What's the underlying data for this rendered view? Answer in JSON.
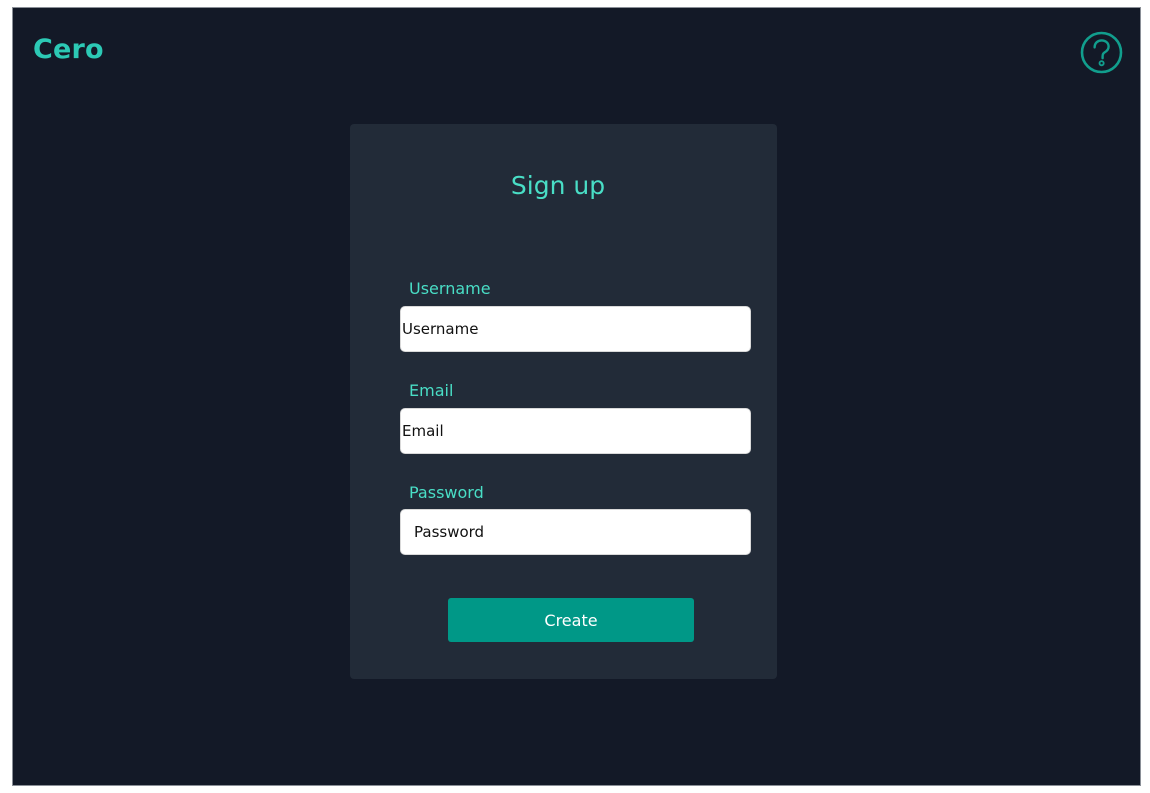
{
  "app": {
    "logo": "Cero",
    "help_icon": "question-circle-icon"
  },
  "signup": {
    "title": "Sign up",
    "username_label": "Username",
    "username_placeholder": "Username",
    "email_label": "Email",
    "email_placeholder": "Email",
    "password_label": "Password",
    "password_placeholder": "Password",
    "create_label": "Create"
  },
  "colors": {
    "background": "#131927",
    "card": "#222b38",
    "accent": "#49dec6",
    "logo": "#2cc9b5",
    "button": "#009887"
  }
}
